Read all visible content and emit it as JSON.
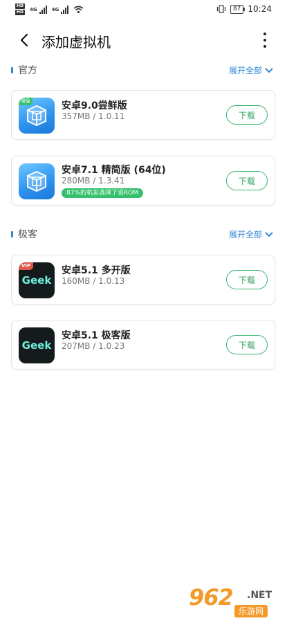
{
  "status_bar": {
    "hd1": "HD 1",
    "hd2": "HD 2",
    "net1": "4G",
    "net2": "4G",
    "battery": "87",
    "time": "10:24"
  },
  "header": {
    "title": "添加虚拟机"
  },
  "sections": [
    {
      "title": "官方",
      "expand_label": "展开全部",
      "apps": [
        {
          "name": "安卓9.0尝鲜版",
          "meta": "357MB / 1.0.11",
          "tag": "限免",
          "icon": "virtual-box-icon",
          "button": "下载"
        },
        {
          "name": "安卓7.1 精简版 (64位)",
          "meta": "280MB / 1.3.41",
          "badge": "87%的机友选择了该ROM",
          "icon": "virtual-box-icon",
          "button": "下载"
        }
      ]
    },
    {
      "title": "极客",
      "expand_label": "展开全部",
      "apps": [
        {
          "name": "安卓5.1 多开版",
          "meta": "160MB / 1.0.13",
          "tag": "VIP",
          "icon_text": "Geek",
          "button": "下载"
        },
        {
          "name": "安卓5.1 极客版",
          "meta": "207MB / 1.0.23",
          "icon_text": "Geek",
          "button": "下载"
        }
      ]
    }
  ],
  "watermark": {
    "number": "962",
    "domain": ".NET",
    "subtitle": "乐游网"
  },
  "colors": {
    "accent_blue": "#2f86d8",
    "button_green": "#35b46a",
    "badge_green": "#35c06b"
  }
}
